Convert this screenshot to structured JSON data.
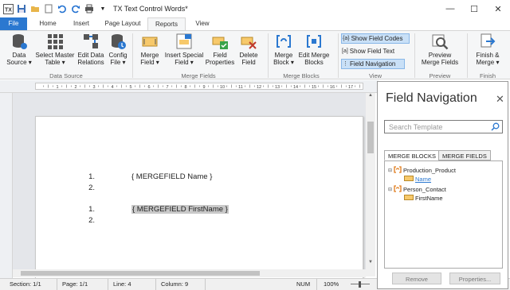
{
  "title_bar": {
    "title": "TX Text Control Words*"
  },
  "tabs": [
    {
      "label": "File"
    },
    {
      "label": "Home"
    },
    {
      "label": "Insert"
    },
    {
      "label": "Page Layout"
    },
    {
      "label": "Reports"
    },
    {
      "label": "View"
    }
  ],
  "ribbon": {
    "data_source": {
      "data_source_1": "Data",
      "data_source_2": "Source",
      "select_master_1": "Select Master",
      "select_master_2": "Table",
      "edit_relations_1": "Edit Data",
      "edit_relations_2": "Relations",
      "config_file_1": "Config",
      "config_file_2": "File",
      "group_label": "Data Source"
    },
    "merge_fields": {
      "merge_field_1": "Merge",
      "merge_field_2": "Field",
      "insert_special_1": "Insert Special",
      "insert_special_2": "Field",
      "field_props_1": "Field",
      "field_props_2": "Properties",
      "delete_field_1": "Delete",
      "delete_field_2": "Field",
      "group_label": "Merge Fields"
    },
    "merge_blocks": {
      "merge_block_1": "Merge",
      "merge_block_2": "Block",
      "edit_blocks_1": "Edit Merge",
      "edit_blocks_2": "Blocks",
      "group_label": "Merge Blocks"
    },
    "view": {
      "show_field_codes": "Show Field Codes",
      "show_field_text": "Show Field Text",
      "field_navigation": "Field Navigation",
      "group_label": "View"
    },
    "preview": {
      "preview_1": "Preview",
      "preview_2": "Merge Fields",
      "group_label": "Preview"
    },
    "finish": {
      "finish_1": "Finish &",
      "finish_2": "Merge",
      "group_label": "Finish"
    }
  },
  "ruler_labels": [
    "1",
    "2",
    "3",
    "4",
    "5",
    "6",
    "7",
    "8",
    "9",
    "10",
    "11",
    "12",
    "13",
    "14",
    "15",
    "16",
    "17"
  ],
  "document": {
    "list1": [
      {
        "num": "1.",
        "text": "{ MERGEFIELD Name }"
      },
      {
        "num": "2.",
        "text": ""
      }
    ],
    "list2": [
      {
        "num": "1.",
        "text": "{ MERGEFIELD FirstName }"
      },
      {
        "num": "2.",
        "text": ""
      }
    ]
  },
  "status_bar": {
    "section": "Section: 1/1",
    "page": "Page: 1/1",
    "line": "Line: 4",
    "column": "Column: 9",
    "num": "NUM",
    "zoom": "100%"
  },
  "field_navigation": {
    "title": "Field Navigation",
    "search_placeholder": "Search Template",
    "tab_blocks": "MERGE BLOCKS",
    "tab_fields": "MERGE FIELDS",
    "tree": {
      "block1": "Production_Product",
      "field1": "Name",
      "block2": "Person_Contact",
      "field2": "FirstName"
    },
    "remove_label": "Remove",
    "properties_label": "Properties..."
  },
  "colors": {
    "accent": "#2b78d0",
    "ribbon_bg": "#f5f6f7",
    "toggle_active": "#c9e0f7"
  }
}
